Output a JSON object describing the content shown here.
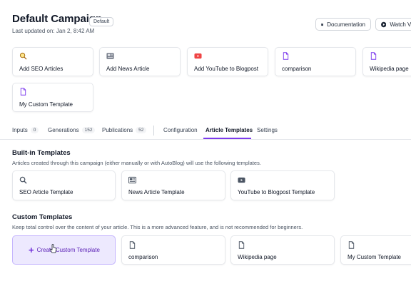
{
  "header": {
    "title": "Default Campaign",
    "badge": "Default",
    "last_updated": "Last updated on: Jan 2, 8:42 AM",
    "buttons": {
      "documentation": "Documentation",
      "watch": "Watch Vi"
    }
  },
  "quick_actions": [
    {
      "label": "Add SEO Articles",
      "icon": "sparkle-search-icon"
    },
    {
      "label": "Add News Article",
      "icon": "newspaper-icon"
    },
    {
      "label": "Add YouTube to Blogpost",
      "icon": "youtube-icon"
    },
    {
      "label": "comparison",
      "icon": "document-icon"
    },
    {
      "label": "Wikipedia page",
      "icon": "document-icon"
    },
    {
      "label": "My Custom Template",
      "icon": "document-icon"
    }
  ],
  "tabs": [
    {
      "label": "Inputs",
      "count": "0"
    },
    {
      "label": "Generations",
      "count": "152"
    },
    {
      "label": "Publications",
      "count": "52"
    },
    {
      "label": "Configuration"
    },
    {
      "label": "Article Templates",
      "active": true
    },
    {
      "label": "Settings"
    }
  ],
  "builtin": {
    "heading": "Built-in Templates",
    "description": "Articles created through this campaign (either manually or with AutoBlog) will use the following templates.",
    "templates": [
      {
        "label": "SEO Article Template",
        "icon": "search-icon"
      },
      {
        "label": "News Article Template",
        "icon": "newspaper-icon"
      },
      {
        "label": "YouTube to Blogpost Template",
        "icon": "youtube-icon"
      }
    ]
  },
  "custom": {
    "heading": "Custom Templates",
    "description": "Keep total control over the content of your article. This is a more advanced feature, and is not recommended for beginners.",
    "create_label": "Create Custom Template",
    "templates": [
      {
        "label": "comparison",
        "icon": "document-icon"
      },
      {
        "label": "Wikipedia page",
        "icon": "document-icon"
      },
      {
        "label": "My Custom Template",
        "icon": "document-icon"
      }
    ]
  },
  "colors": {
    "accent": "#7c3aed",
    "youtube_red": "#ef4444",
    "create_bg": "#ede9fe"
  }
}
